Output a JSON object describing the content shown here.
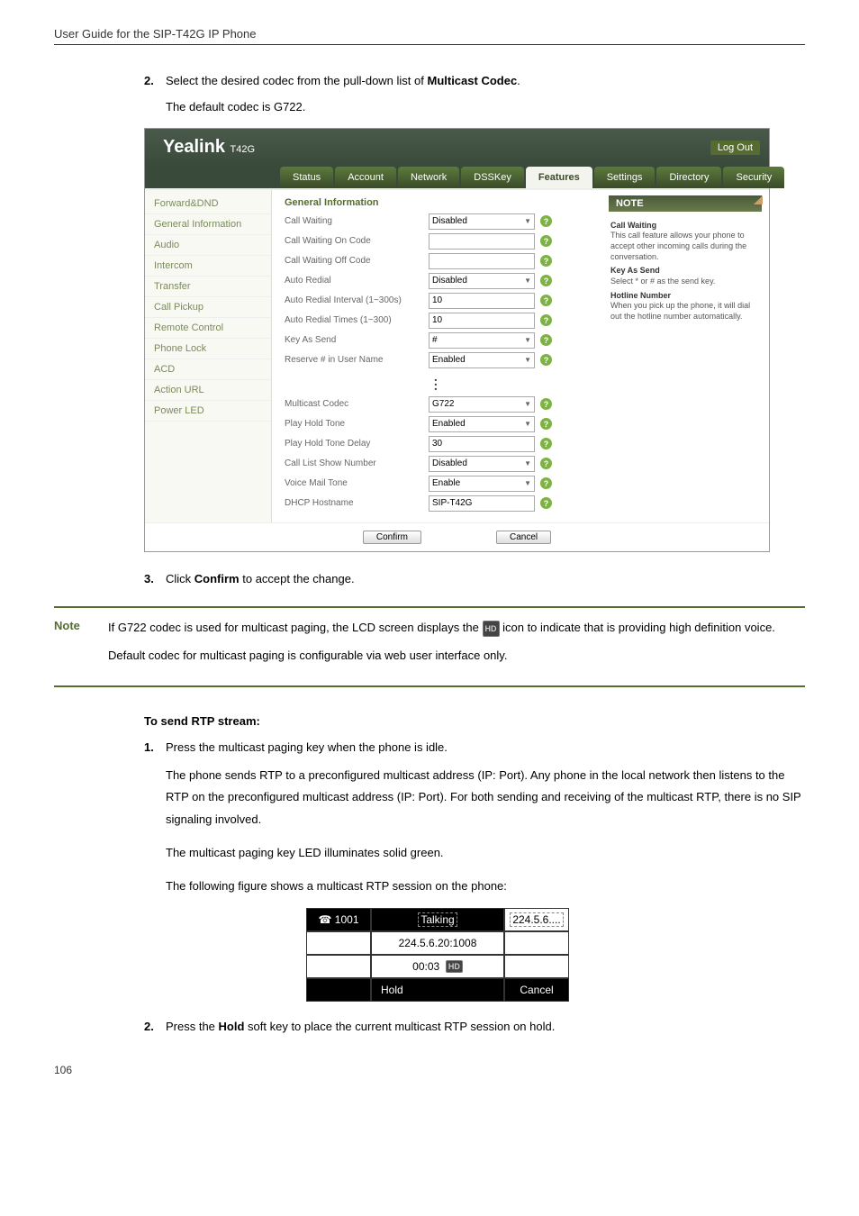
{
  "header": "User Guide for the SIP-T42G IP Phone",
  "step2": {
    "num": "2.",
    "text_before": "Select the desired codec from the pull-down list of ",
    "bold": "Multicast Codec",
    "text_after": ".",
    "sub": "The default codec is G722."
  },
  "screenshot": {
    "logo": "Yealink",
    "logo_sub": "T42G",
    "logout": "Log Out",
    "tabs": [
      "Status",
      "Account",
      "Network",
      "DSSKey",
      "Features",
      "Settings",
      "Directory",
      "Security"
    ],
    "active_tab": "Features",
    "sidebar": [
      "Forward&DND",
      "General Information",
      "Audio",
      "Intercom",
      "Transfer",
      "Call Pickup",
      "Remote Control",
      "Phone Lock",
      "ACD",
      "Action URL",
      "Power LED"
    ],
    "section": "General Information",
    "rows_top": [
      {
        "label": "Call Waiting",
        "value": "Disabled",
        "select": true
      },
      {
        "label": "Call Waiting On Code",
        "value": "",
        "select": false
      },
      {
        "label": "Call Waiting Off Code",
        "value": "",
        "select": false
      },
      {
        "label": "Auto Redial",
        "value": "Disabled",
        "select": true
      },
      {
        "label": "Auto Redial Interval (1~300s)",
        "value": "10",
        "select": false
      },
      {
        "label": "Auto Redial Times (1~300)",
        "value": "10",
        "select": false
      },
      {
        "label": "Key As Send",
        "value": "#",
        "select": true
      },
      {
        "label": "Reserve # in User Name",
        "value": "Enabled",
        "select": true
      }
    ],
    "rows_bottom": [
      {
        "label": "Multicast Codec",
        "value": "G722",
        "select": true
      },
      {
        "label": "Play Hold Tone",
        "value": "Enabled",
        "select": true
      },
      {
        "label": "Play Hold Tone Delay",
        "value": "30",
        "select": false
      },
      {
        "label": "Call List Show Number",
        "value": "Disabled",
        "select": true
      },
      {
        "label": "Voice Mail Tone",
        "value": "Enable",
        "select": true
      },
      {
        "label": "DHCP Hostname",
        "value": "SIP-T42G",
        "select": false
      }
    ],
    "confirm": "Confirm",
    "cancel": "Cancel",
    "note_panel": {
      "title": "NOTE",
      "items": [
        {
          "head": "Call Waiting",
          "body": "This call feature allows your phone to accept other incoming calls during the conversation."
        },
        {
          "head": "Key As Send",
          "body": "Select * or # as the send key."
        },
        {
          "head": "Hotline Number",
          "body": "When you pick up the phone, it will dial out the hotline number automatically."
        }
      ]
    }
  },
  "step3": {
    "num": "3.",
    "text_before": "Click ",
    "bold": "Confirm",
    "text_after": " to accept the change."
  },
  "note": {
    "label": "Note",
    "p1a": "If G722 codec is used for multicast paging, the LCD screen displays the ",
    "p1b": " icon to indicate that is providing high definition voice.",
    "p2": "Default codec for multicast paging is configurable via web user interface only."
  },
  "rtp_heading": "To send RTP stream:",
  "rtp_step1": {
    "num": "1.",
    "text": "Press the multicast paging key when the phone is idle.",
    "p1": "The phone sends RTP to a preconfigured multicast address (IP: Port). Any phone in the local network then listens to the RTP on the preconfigured multicast address (IP: Port). For both sending and receiving of the multicast RTP, there is no SIP signaling involved.",
    "p2": "The multicast paging key LED illuminates solid green.",
    "p3": "The following figure shows a multicast RTP session on the phone:"
  },
  "phone": {
    "line": "1001",
    "status": "Talking",
    "ip_short": "224.5.6....",
    "addr": "224.5.6.20:1008",
    "time": "00:03",
    "hold": "Hold",
    "cancel": "Cancel"
  },
  "rtp_step2": {
    "num": "2.",
    "text_before": "Press the ",
    "bold": "Hold",
    "text_after": " soft key to place the current multicast RTP session on hold."
  },
  "page_num": "106"
}
